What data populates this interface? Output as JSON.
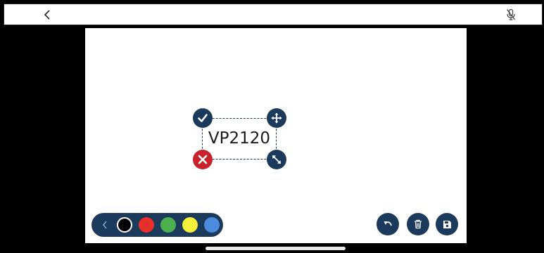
{
  "canvas": {
    "text_label": "VP2120"
  },
  "icons": {
    "back": "chevron-left-icon",
    "mic": "microphone-mute-icon",
    "confirm": "checkmark-icon",
    "move": "move-arrows-icon",
    "delete": "close-icon",
    "resize": "resize-arrows-icon",
    "palette_collapse": "chevron-left-icon",
    "undo": "undo-icon",
    "trash": "trash-icon",
    "save": "save-icon"
  },
  "palette": {
    "colors": [
      "#000000",
      "#e8302b",
      "#4caf50",
      "#f5ee3a",
      "#4a8bdc"
    ],
    "selected": "#000000"
  },
  "theme": {
    "accent": "#1b3a5c",
    "danger": "#c8232c"
  }
}
